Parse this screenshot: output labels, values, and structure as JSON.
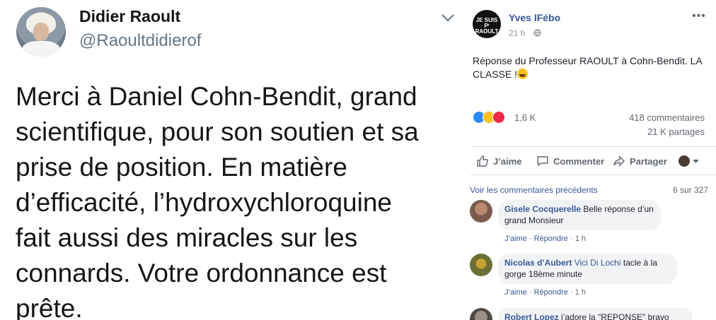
{
  "tweet": {
    "name": "Didier Raoult",
    "handle": "@Raoultdidierof",
    "lines": [
      "Merci à Daniel Cohn-Bendit, grand",
      "scientifique, pour son soutien et sa",
      "prise de position. En matière",
      "d’efficacité, l’hydroxychloroquine",
      "fait aussi des miracles sur les",
      "connards. Votre ordonnance est",
      "prête."
    ]
  },
  "fb": {
    "page_name": "Yves IFébo",
    "avatar_text": [
      "JE SUIS",
      "Pʳ RAOULT"
    ],
    "time": "21 h",
    "post_text": "Réponse du Professeur RAOULT à Cohn-Bendit. LA CLASSE !",
    "reaction_count": "1,6 K",
    "comments_count": "418 commentaires",
    "shares_count": "21 K partages",
    "actions": {
      "like": "J’aime",
      "comment": "Commenter",
      "share": "Partager"
    },
    "previous_comments": "Voir les commentaires précédents",
    "comments_position": "6 sur 327",
    "comments": [
      {
        "author": "Gisele Cocquerelle",
        "tag": "",
        "text": "Belle réponse d’un grand Monsieur",
        "like": "J’aime",
        "reply": "Répondre",
        "time": "1 h"
      },
      {
        "author": "Nicolas d’Aubert",
        "tag": "Vici Di Lochi",
        "text": "tacle à la gorge 18ème minute",
        "like": "J’aime",
        "reply": "Répondre",
        "time": "1 h"
      },
      {
        "author": "Robert Lopez",
        "tag": "",
        "text": "j’adore la \"REPONSE\" bravo",
        "like": "",
        "reply": "",
        "time": ""
      }
    ]
  }
}
